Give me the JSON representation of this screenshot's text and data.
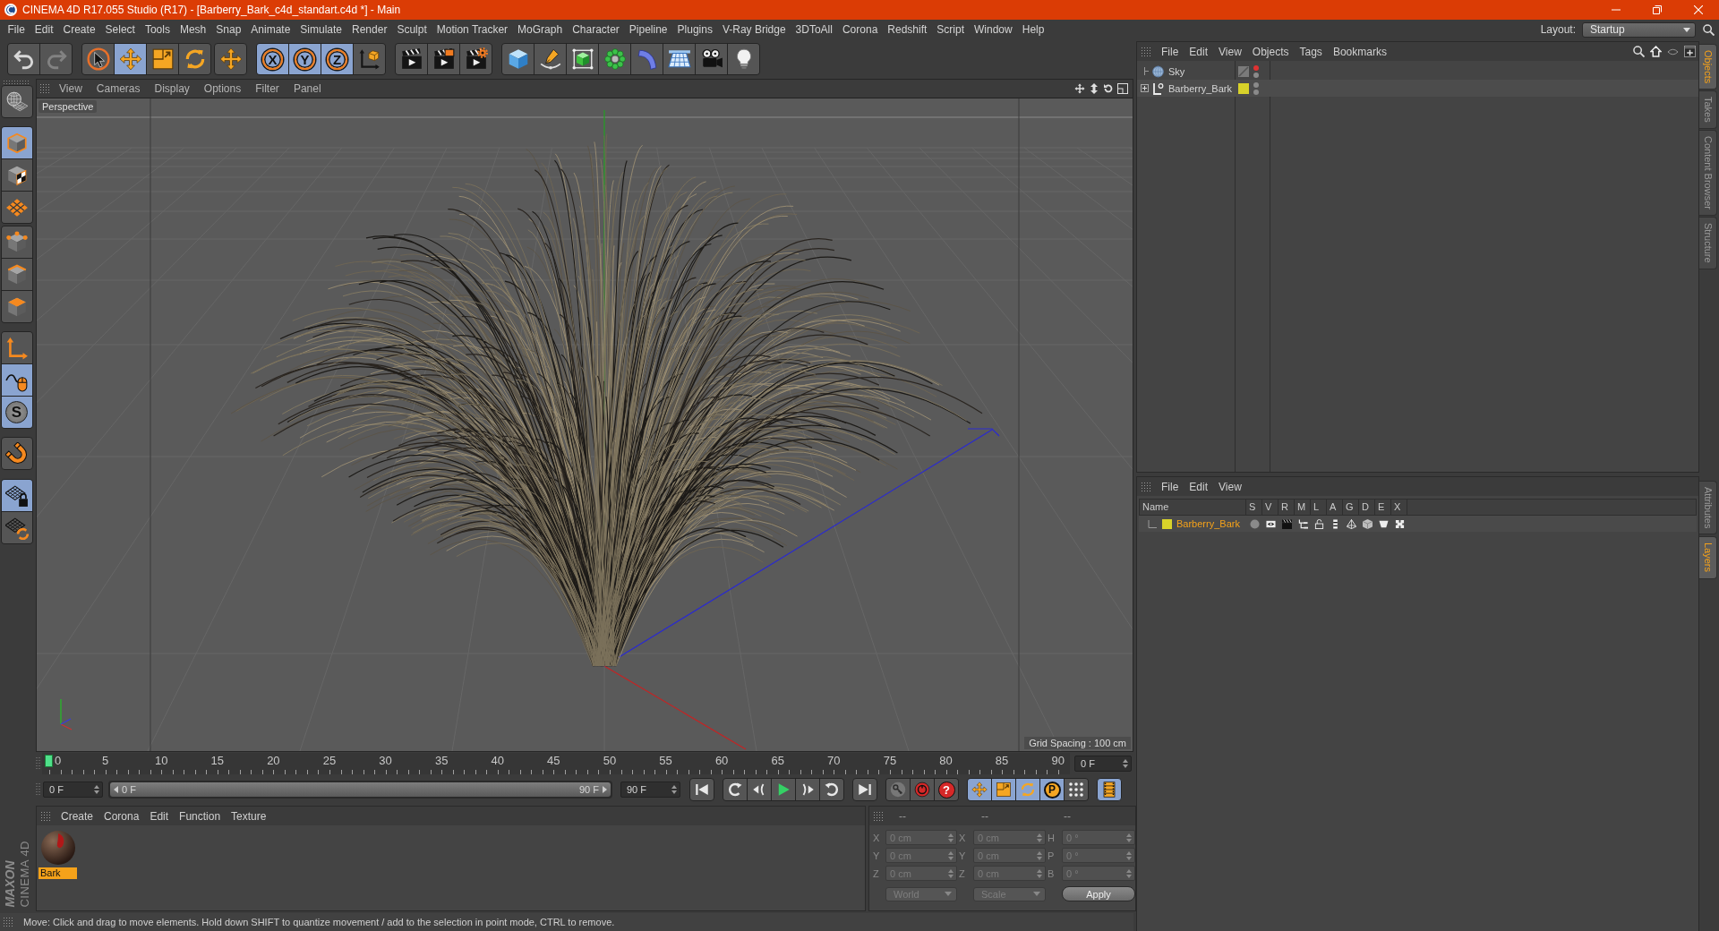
{
  "window": {
    "title": "CINEMA 4D R17.055 Studio (R17) - [Barberry_Bark_c4d_standart.c4d *] - Main"
  },
  "menu_bar": {
    "items": [
      "File",
      "Edit",
      "Create",
      "Select",
      "Tools",
      "Mesh",
      "Snap",
      "Animate",
      "Simulate",
      "Render",
      "Sculpt",
      "Motion Tracker",
      "MoGraph",
      "Character",
      "Pipeline",
      "Plugins",
      "V-Ray Bridge",
      "3DToAll",
      "Corona",
      "Redshift",
      "Script",
      "Window",
      "Help"
    ],
    "layout_label": "Layout:",
    "layout_value": "Startup"
  },
  "toolbar": {
    "groups": [
      [
        {
          "kind": "undo",
          "selected": false,
          "disabled": false
        },
        {
          "kind": "redo",
          "selected": false,
          "disabled": true
        }
      ],
      [
        {
          "kind": "live-select",
          "selected": false,
          "disabled": false
        },
        {
          "kind": "move",
          "selected": true,
          "disabled": false
        },
        {
          "kind": "scale",
          "selected": false,
          "disabled": false
        },
        {
          "kind": "rotate",
          "selected": false,
          "disabled": false
        }
      ],
      [
        {
          "kind": "move",
          "selected": false,
          "disabled": false
        }
      ],
      [
        {
          "kind": "axis-lock",
          "label": "X",
          "selected": true,
          "disabled": false
        },
        {
          "kind": "axis-lock",
          "label": "Y",
          "selected": true,
          "disabled": false
        },
        {
          "kind": "axis-lock",
          "label": "Z",
          "selected": true,
          "disabled": false
        },
        {
          "kind": "coordinate-system",
          "selected": false,
          "disabled": false
        }
      ],
      [
        {
          "kind": "render-view",
          "selected": false,
          "disabled": false
        },
        {
          "kind": "render-picture",
          "selected": false,
          "disabled": false
        },
        {
          "kind": "render-settings",
          "selected": false,
          "disabled": false
        }
      ],
      [
        {
          "kind": "cube",
          "selected": false,
          "disabled": false
        },
        {
          "kind": "pen",
          "selected": false,
          "disabled": false
        },
        {
          "kind": "subdivision",
          "selected": false,
          "disabled": false
        },
        {
          "kind": "cloner",
          "selected": false,
          "disabled": false
        },
        {
          "kind": "bend",
          "selected": false,
          "disabled": false
        },
        {
          "kind": "floor",
          "selected": false,
          "disabled": false
        },
        {
          "kind": "camera",
          "selected": false,
          "disabled": false
        },
        {
          "kind": "light",
          "selected": false,
          "disabled": false
        }
      ]
    ]
  },
  "left_toolbar": {
    "groups": [
      [
        {
          "kind": "make-editable",
          "selected": false
        }
      ],
      [
        {
          "kind": "model",
          "selected": true
        },
        {
          "kind": "texture",
          "selected": false
        },
        {
          "kind": "workplane",
          "selected": false
        }
      ],
      [
        {
          "kind": "points",
          "selected": false
        },
        {
          "kind": "edges",
          "selected": false
        },
        {
          "kind": "polygons",
          "selected": false
        }
      ],
      [
        {
          "kind": "axis",
          "selected": false
        },
        {
          "kind": "tweak",
          "selected": true
        },
        {
          "kind": "snap",
          "label": "S",
          "selected": true
        }
      ],
      [
        {
          "kind": "magnet",
          "selected": false
        }
      ],
      [
        {
          "kind": "lock-workplane",
          "selected": true
        },
        {
          "kind": "align-workplane",
          "selected": false
        }
      ]
    ]
  },
  "viewport": {
    "menu": [
      "View",
      "Cameras",
      "Display",
      "Options",
      "Filter",
      "Panel"
    ],
    "camera": "Perspective",
    "grid_spacing": "Grid Spacing : 100 cm"
  },
  "timeline": {
    "ticks": [
      "0",
      "5",
      "10",
      "15",
      "20",
      "25",
      "30",
      "35",
      "40",
      "45",
      "50",
      "55",
      "60",
      "65",
      "70",
      "75",
      "80",
      "85",
      "90"
    ],
    "current_frame": "0 F"
  },
  "transport": {
    "start_field": "0 F",
    "range": {
      "start": "0 F",
      "end": "90 F",
      "level": 1
    },
    "end_field": "90 F",
    "groups": [
      [
        {
          "kind": "go-start",
          "selected": false
        }
      ],
      [
        {
          "kind": "prev-key",
          "selected": false
        },
        {
          "kind": "prev-frame",
          "selected": false
        },
        {
          "kind": "play",
          "selected": false
        },
        {
          "kind": "next-frame",
          "selected": false
        },
        {
          "kind": "next-key",
          "selected": false
        }
      ],
      [
        {
          "kind": "go-end",
          "selected": false
        }
      ],
      [
        {
          "kind": "keyframe-selection",
          "selected": false
        },
        {
          "kind": "record",
          "selected": false
        },
        {
          "kind": "autokey",
          "label": "?",
          "selected": false
        }
      ],
      [
        {
          "kind": "key-position",
          "selected": true
        },
        {
          "kind": "key-scale",
          "selected": true
        },
        {
          "kind": "key-rotation",
          "selected": true
        },
        {
          "kind": "key-parameter",
          "label": "P",
          "selected": true
        },
        {
          "kind": "key-point-level",
          "selected": false
        }
      ],
      [
        {
          "kind": "timeline",
          "selected": true
        }
      ]
    ]
  },
  "material_manager": {
    "menu": [
      "Create",
      "Corona",
      "Edit",
      "Function",
      "Texture"
    ],
    "materials": [
      {
        "name": "Bark",
        "selected": true
      }
    ]
  },
  "coordinates": {
    "disabled": true,
    "headers": [
      "--",
      "--",
      "--"
    ],
    "rows": [
      {
        "axis": "X",
        "position": "0 cm",
        "size_axis": "X",
        "size": "0 cm",
        "rotation_axis": "H",
        "rotation": "0 °"
      },
      {
        "axis": "Y",
        "position": "0 cm",
        "size_axis": "Y",
        "size": "0 cm",
        "rotation_axis": "P",
        "rotation": "0 °"
      },
      {
        "axis": "Z",
        "position": "0 cm",
        "size_axis": "Z",
        "size": "0 cm",
        "rotation_axis": "B",
        "rotation": "0 °"
      }
    ],
    "space": "World",
    "mode": "Scale",
    "apply": "Apply"
  },
  "status_bar": {
    "text": "Move: Click and drag to move elements. Hold down SHIFT to quantize movement / add to the selection in point mode, CTRL to remove."
  },
  "logo": {
    "brand": "MAXON",
    "product": "CINEMA 4D"
  },
  "object_manager": {
    "menu": [
      "File",
      "Edit",
      "View",
      "Objects",
      "Tags",
      "Bookmarks"
    ],
    "objects": [
      {
        "name": "Sky",
        "kind": "sky",
        "collapsed": false,
        "visible_in_editor": false,
        "visible_in_render": true
      },
      {
        "name": "Barberry_Bark",
        "kind": "null",
        "collapsed": true,
        "visible_in_editor": true,
        "visible_in_render": true,
        "color": "#d8d22a"
      }
    ]
  },
  "layer_manager": {
    "menu": [
      "File",
      "Edit",
      "View"
    ],
    "columns": [
      "Name",
      "S",
      "V",
      "R",
      "M",
      "L",
      "A",
      "G",
      "D",
      "E",
      "X"
    ],
    "layers": [
      {
        "name": "Barberry_Bark",
        "color": "#d8d22a",
        "selected": true,
        "flags": {
          "solo": false,
          "visible": true,
          "render": true,
          "manager": true,
          "locked": false,
          "animation": true,
          "generators": true,
          "deformers": true,
          "expressions": true,
          "xref": true
        }
      }
    ]
  },
  "side_tabs": {
    "top": [
      {
        "label": "Objects",
        "selected": true
      },
      {
        "label": "Takes",
        "selected": false
      },
      {
        "label": "Content Browser",
        "selected": false
      },
      {
        "label": "Structure",
        "selected": false
      }
    ],
    "bottom": [
      {
        "label": "Attributes",
        "selected": false
      },
      {
        "label": "Layers",
        "selected": true
      }
    ]
  }
}
